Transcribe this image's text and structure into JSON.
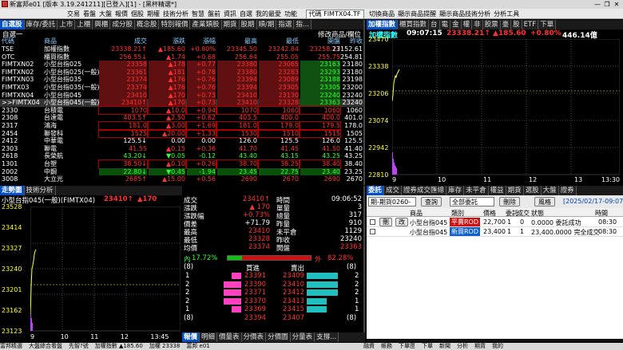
{
  "window": {
    "title": "新富邦e01 [版本 3.19.241211][已登入][1] - [黑杯精選*]",
    "min": "—",
    "max": "❐",
    "close": "✕"
  },
  "menu": {
    "items": [
      "交易",
      "看盤",
      "大盤",
      "報價",
      "個股",
      "期權",
      "技術分析",
      "智慧",
      "盤前",
      "資訊",
      "自選",
      "我的最愛",
      "功能"
    ],
    "symbol": "代碼 FIMTX04.TF",
    "right": [
      "切換商品",
      "顯示商品提醒",
      "顯示商品技術分析",
      "分析工具"
    ]
  },
  "quote": {
    "tabs": [
      "自選股",
      "庫存/委託",
      "上市",
      "上櫃",
      "興櫃",
      "成分股",
      "概念股",
      "特別報價",
      "產業類股",
      "期貨",
      "股期",
      "順/期",
      "指選",
      "指..."
    ],
    "sub_left": "自選一",
    "sub_right": "修改商品/欄位",
    "headers": [
      "代碼",
      "商品",
      "成交",
      "漲跌",
      "漲幅",
      "最高",
      "最低",
      "開盤",
      "昨收"
    ],
    "rows": [
      {
        "code": "TSE",
        "name": "加權指數",
        "last": "23338.21↑",
        "chg": "▲185.60",
        "pct": "+0.80%",
        "high": "23345.50",
        "low": "23242.84",
        "open": "23258.17",
        "prev": "23152.61",
        "cc": "red",
        "hb": ""
      },
      {
        "code": "OTC",
        "name": "櫃買指數",
        "last": "256.55↓",
        "chg": "▲1.74",
        "pct": "+0.68",
        "high": "256.64",
        "low": "255.05",
        "open": "255.75",
        "prev": "254.81",
        "cc": "red",
        "hb": ""
      },
      {
        "code": "FIMTXN02",
        "name": "小型台指025",
        "last": "23358",
        "chg": "▲178",
        "pct": "+0.77",
        "high": "23380",
        "low": "23065",
        "open": "23163",
        "prev": "23180",
        "cc": "red",
        "hb": "hl"
      },
      {
        "code": "FIMTXN02",
        "name": "小型台指025(一般)",
        "last": "23361",
        "chg": "▲181",
        "pct": "+0.78",
        "high": "23380",
        "low": "23283",
        "open": "23293",
        "prev": "23180",
        "cc": "red",
        "hb": "hl"
      },
      {
        "code": "FIMTXN03",
        "name": "小型台指035",
        "last": "23374",
        "chg": "▲176",
        "pct": "+0.76",
        "high": "23394",
        "low": "23089",
        "open": "23188",
        "prev": "23198",
        "cc": "red",
        "hb": "hl"
      },
      {
        "code": "FIMTX03",
        "name": "小型台指035(一般)",
        "last": "23374",
        "chg": "▲176",
        "pct": "+0.76",
        "high": "23394",
        "low": "23305",
        "open": "23305",
        "prev": "23200",
        "cc": "red",
        "hb": "hl"
      },
      {
        "code": "FIMTXN04",
        "name": "小型台指045",
        "last": "23410",
        "chg": "▲170",
        "pct": "+0.73",
        "high": "23410",
        "low": "23130",
        "open": "23240",
        "prev": "23240",
        "cc": "red",
        "hb": "hl"
      },
      {
        "code": ">>FIMTX04",
        "name": "小型台指045(一般)",
        "last": "23410↑",
        "chg": "▲170",
        "pct": "+0.73",
        "high": "23410",
        "low": "23328",
        "open": "23363",
        "prev": "23240",
        "cc": "red",
        "hb": "hl"
      },
      {
        "code": "2330",
        "name": "台積電",
        "last": "1070",
        "chg": "▲10.0",
        "pct": "+0.94",
        "high": "1070",
        "low": "1060",
        "open": "1060",
        "prev": "1060",
        "cc": "red",
        "hb": "box"
      },
      {
        "code": "2308",
        "name": "台達電",
        "last": "403.5↑",
        "chg": "▲2.50",
        "pct": "+0.62",
        "high": "403.5",
        "low": "400.0",
        "open": "400.0",
        "prev": "401.0",
        "cc": "red",
        "hb": ""
      },
      {
        "code": "2317",
        "name": "鴻海",
        "last": "181.0",
        "chg": "▲3.00",
        "pct": "+1.69",
        "high": "181.0",
        "low": "179.0",
        "open": "179.5",
        "prev": "178.0",
        "cc": "red",
        "hb": "box"
      },
      {
        "code": "2454",
        "name": "聯發科",
        "last": "1525",
        "chg": "▲20.00",
        "pct": "+1.33",
        "high": "1530",
        "low": "1510",
        "open": "1515",
        "prev": "1505",
        "cc": "red",
        "hb": "box"
      },
      {
        "code": "2412",
        "name": "中華電",
        "last": "125.5↓",
        "chg": "0.00",
        "pct": "0.00",
        "high": "126.0",
        "low": "125.5",
        "open": "126.0",
        "prev": "125.5",
        "cc": "wht",
        "hb": ""
      },
      {
        "code": "2303",
        "name": "聯電",
        "last": "41.55",
        "chg": "▲0.15",
        "pct": "+0.36",
        "high": "41.70",
        "low": "41.45",
        "open": "41.50",
        "prev": "41.40",
        "cc": "red",
        "hb": ""
      },
      {
        "code": "2618",
        "name": "長榮航",
        "last": "43.20↓",
        "chg": "▼0.05",
        "pct": "-0.12",
        "high": "43.40",
        "low": "43.15",
        "open": "43.25",
        "prev": "43.25",
        "cc": "grn",
        "hb": ""
      },
      {
        "code": "1301",
        "name": "台塑",
        "last": "38.50↓",
        "chg": "▲0.10",
        "pct": "+0.26",
        "high": "38.70",
        "low": "38.25",
        "open": "38.40",
        "prev": "38.40",
        "cc": "red",
        "hb": "box"
      },
      {
        "code": "2002",
        "name": "中鋼",
        "last": "22.80↓",
        "chg": "▼0.45",
        "pct": "-1.94",
        "high": "23.45",
        "low": "22.75",
        "open": "23.40",
        "prev": "23.25",
        "cc": "grn",
        "hb": "gbox"
      },
      {
        "code": "3008",
        "name": "大立光",
        "last": "2685↑",
        "chg": "▲15.00",
        "pct": "+0.56",
        "high": "2690",
        "low": "2670",
        "open": "2690",
        "prev": "2670",
        "cc": "red",
        "hb": ""
      }
    ]
  },
  "index_chart": {
    "tabs": [
      "加權指數",
      "櫃買指數",
      "台",
      "電",
      "金",
      "權",
      "非",
      "股票",
      "臺",
      "股",
      "ETF",
      "下單"
    ],
    "name": "加權指數",
    "time": "09:07:15",
    "value": "23338.21↑",
    "chg": "▲185.60",
    "pct": "+0.80%",
    "vol": "446.14億",
    "yticks": [
      "23470",
      "23338",
      "23206",
      "23074",
      "22942",
      "22810"
    ],
    "xticks": [
      "9",
      "10",
      "11",
      "12",
      "13"
    ],
    "time_end": "13:30"
  },
  "tick": {
    "tabs": [
      "走勢圖",
      "技術分析"
    ],
    "title": "小型台指045(一般)(FIMTX04)",
    "last": "23410↑",
    "chg": "▲170",
    "yticks": [
      "23528",
      "23414",
      "23327",
      "23240",
      "23201",
      "23162",
      "23123"
    ],
    "xticks": [
      "9",
      "10",
      "11",
      "12",
      "13:45"
    ],
    "info": [
      {
        "l": "成交",
        "v": "23410↑",
        "c": "red",
        "l2": "時間",
        "v2": "09:06:52",
        "c2": "wht"
      },
      {
        "l": "漲跌",
        "v": "▲ 170",
        "c": "red",
        "l2": "單量",
        "v2": "3",
        "c2": "wht"
      },
      {
        "l": "漲跌幅",
        "v": "+0.73%",
        "c": "red",
        "l2": "總量",
        "v2": "317",
        "c2": "wht"
      },
      {
        "l": "價差",
        "v": "+71.79",
        "c": "wht",
        "l2": "昨量",
        "v2": "910",
        "c2": "wht"
      },
      {
        "l": "最高",
        "v": "23410",
        "c": "red",
        "l2": "未平倉",
        "v2": "1129",
        "c2": "wht"
      },
      {
        "l": "最低",
        "v": "23328",
        "c": "red",
        "l2": "昨收",
        "v2": "23240",
        "c2": "wht"
      },
      {
        "l": "均價",
        "v": "23374",
        "c": "red",
        "l2": "開盤",
        "v2": "23363",
        "c2": "red"
      }
    ],
    "inner_label": "內",
    "inner_pct": "17.72%",
    "outer_label": "外",
    "outer_pct": "82.28%",
    "inner_ratio": 0.1772,
    "book_headers": [
      "(8)",
      "買進",
      "賣出",
      "(8)"
    ],
    "book": [
      {
        "bq": "1",
        "bp": "23391",
        "ap": "23409",
        "aq": "2",
        "bw": 0.25,
        "aw": 0.55
      },
      {
        "bq": "2",
        "bp": "23390",
        "ap": "23410",
        "aq": "2",
        "bw": 0.45,
        "aw": 0.55
      },
      {
        "bq": "2",
        "bp": "23371",
        "ap": "23412",
        "aq": "2",
        "bw": 0.45,
        "aw": 0.55
      },
      {
        "bq": "2",
        "bp": "23370",
        "ap": "23413",
        "aq": "1",
        "bw": 0.45,
        "aw": 0.35
      },
      {
        "bq": "1",
        "bp": "23369",
        "ap": "23415",
        "aq": "1",
        "bw": 0.25,
        "aw": 0.35
      }
    ],
    "book_total": {
      "bq": "(8)",
      "bp": "23394",
      "ap": "23407",
      "aq": "(8)"
    },
    "bottom_tabs": [
      "報價",
      "明細",
      "價量表",
      "分價表",
      "分價圖",
      "分量表",
      "支撐..."
    ]
  },
  "orders": {
    "tabs": [
      "委託",
      "成交",
      "證券成交匯總",
      "庫存",
      "未平倉",
      "權益",
      "期貨",
      "選股",
      "大盤",
      "證券"
    ],
    "account": "期-期貨0260-",
    "query": "查詢",
    "filter": "全部委託",
    "delete": "刪除",
    "style": "風格",
    "date": "[2025/02/17-09:07",
    "headers": [
      "",
      "",
      "",
      "商品",
      "類別",
      "價格",
      "委託",
      "成交",
      "狀態",
      "時間"
    ],
    "rows": [
      {
        "b1": "刪",
        "b2": "改",
        "item": "小型台指045",
        "type": "平賣ROD",
        "tc": "red",
        "price": "22,700",
        "qty": "1",
        "fill": "0",
        "status": "0.0000 委託成功",
        "time": "08:30"
      },
      {
        "b1": "",
        "b2": "",
        "item": "小型台指045",
        "type": "新買ROD",
        "tc": "cy",
        "price": "23,400",
        "qty": "1",
        "fill": "1",
        "status": "23,400.0000 完全成交",
        "time": "08:30"
      }
    ]
  },
  "status": {
    "items": [
      "富邦精選",
      "大盤綜合看盤",
      "先智?號",
      "加權指數 ▲185.60",
      "加權 23338",
      "富邦 e01"
    ],
    "right": [
      "融資",
      "帳務",
      "下單匣",
      "下單",
      "新聞",
      "分析",
      "期貨",
      "我的"
    ]
  }
}
